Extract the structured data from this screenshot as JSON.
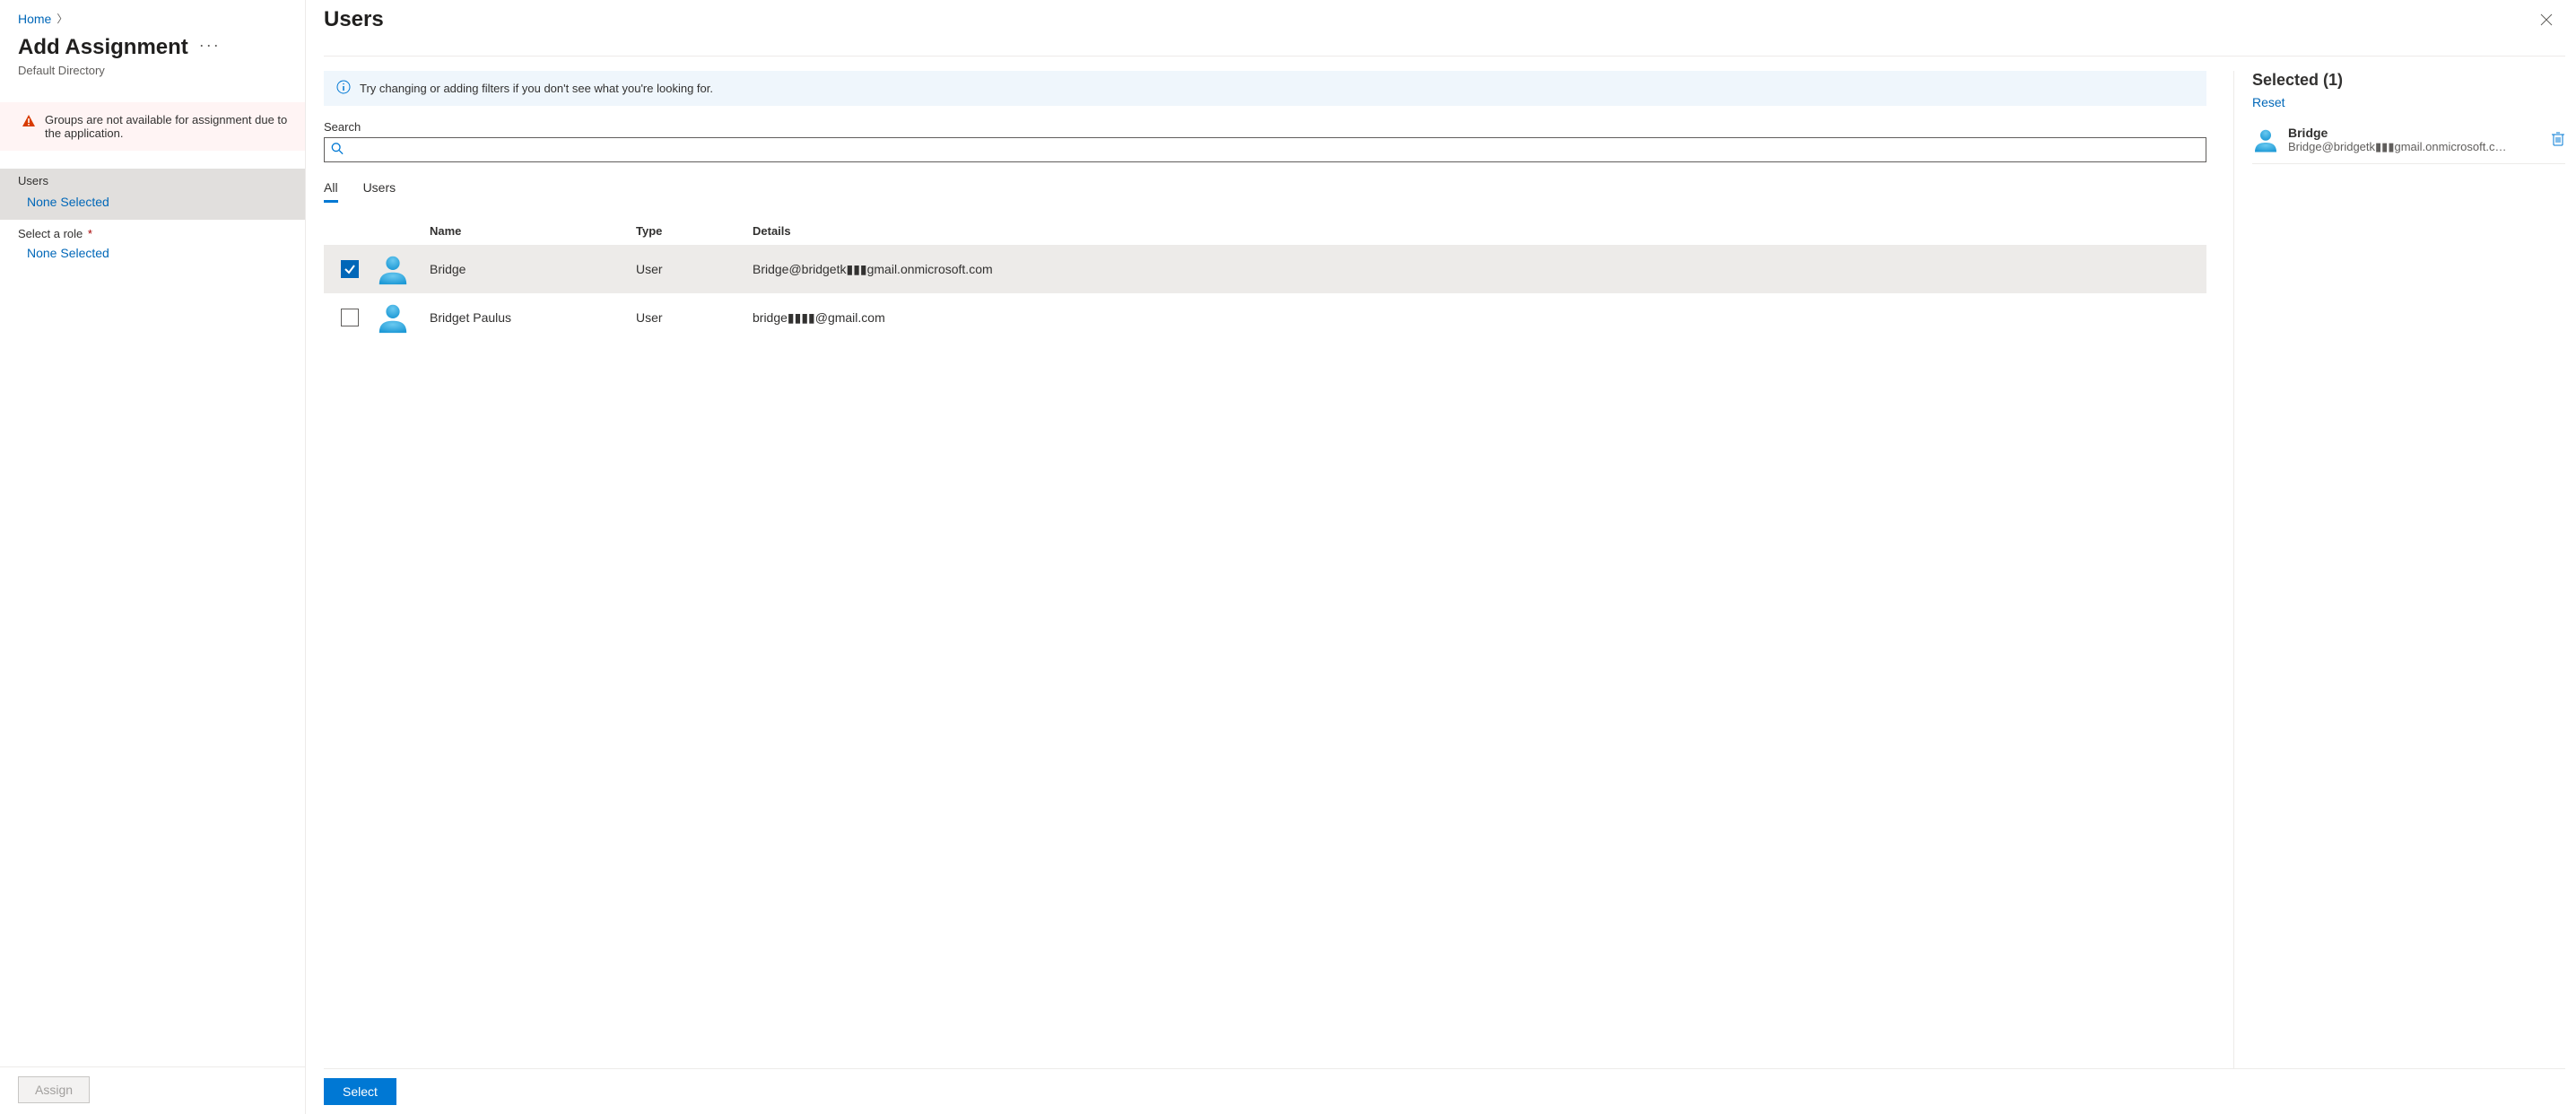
{
  "breadcrumb": {
    "home": "Home"
  },
  "left": {
    "title": "Add Assignment",
    "subtitle": "Default Directory",
    "warning": "Groups are not available for assignment due to the application.",
    "users_label": "Users",
    "users_value": "None Selected",
    "role_label": "Select a role",
    "role_value": "None Selected",
    "assign_label": "Assign"
  },
  "panel": {
    "title": "Users",
    "info": "Try changing or adding filters if you don't see what you're looking for.",
    "search_label": "Search",
    "search_value": "",
    "tabs": {
      "all": "All",
      "users": "Users"
    },
    "columns": {
      "name": "Name",
      "type": "Type",
      "details": "Details"
    },
    "rows": [
      {
        "checked": true,
        "name": "Bridge",
        "type": "User",
        "details": "Bridge@bridgetk▮▮▮gmail.onmicrosoft.com"
      },
      {
        "checked": false,
        "name": "Bridget Paulus",
        "type": "User",
        "details": "bridge▮▮▮▮@gmail.com"
      }
    ],
    "selected_title": "Selected (1)",
    "reset": "Reset",
    "selected_items": [
      {
        "name": "Bridge",
        "email": "Bridge@bridgetk▮▮▮gmail.onmicrosoft.c…"
      }
    ],
    "select_button": "Select"
  }
}
